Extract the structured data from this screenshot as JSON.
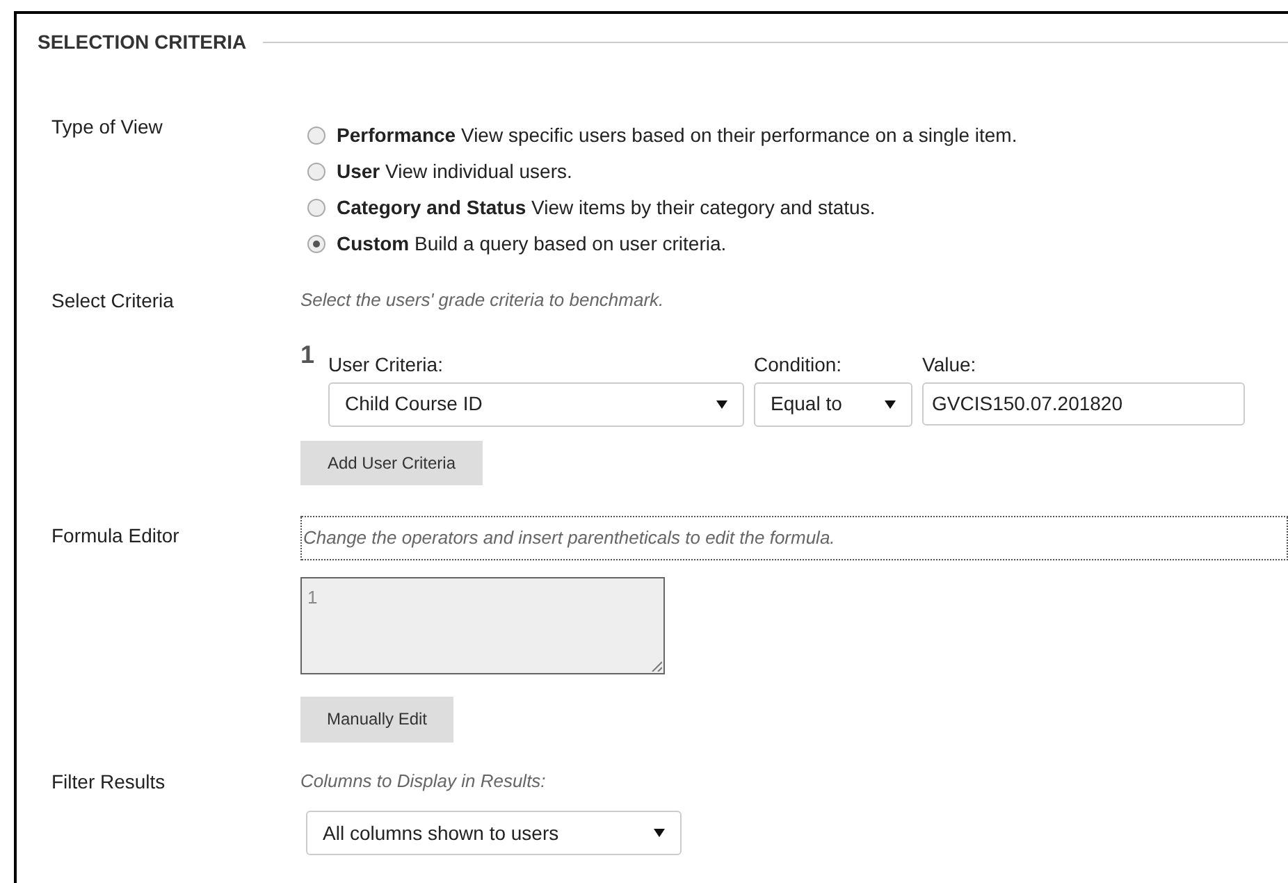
{
  "section": {
    "title": "SELECTION CRITERIA"
  },
  "type_of_view": {
    "label": "Type of View",
    "options": [
      {
        "name": "Performance",
        "description": "View specific users based on their performance on a single item.",
        "selected": false
      },
      {
        "name": "User",
        "description": "View individual users.",
        "selected": false
      },
      {
        "name": "Category and Status",
        "description": "View items by their category and status.",
        "selected": false
      },
      {
        "name": "Custom",
        "description": "Build a query based on user criteria.",
        "selected": true
      }
    ]
  },
  "select_criteria": {
    "label": "Select Criteria",
    "hint": "Select the users' grade criteria to benchmark.",
    "criteria": [
      {
        "number": "1",
        "user_criteria_label": "User Criteria:",
        "user_criteria": "Child Course ID",
        "condition_label": "Condition:",
        "condition": "Equal to",
        "value_label": "Value:",
        "value": "GVCIS150.07.201820"
      }
    ],
    "add_button": "Add User Criteria"
  },
  "formula_editor": {
    "label": "Formula Editor",
    "hint": "Change the operators and insert parentheticals to edit the formula.",
    "formula": "1",
    "button": "Manually Edit"
  },
  "filter_results": {
    "label": "Filter Results",
    "hint": "Columns to Display in Results:",
    "columns": "All columns shown to users"
  }
}
